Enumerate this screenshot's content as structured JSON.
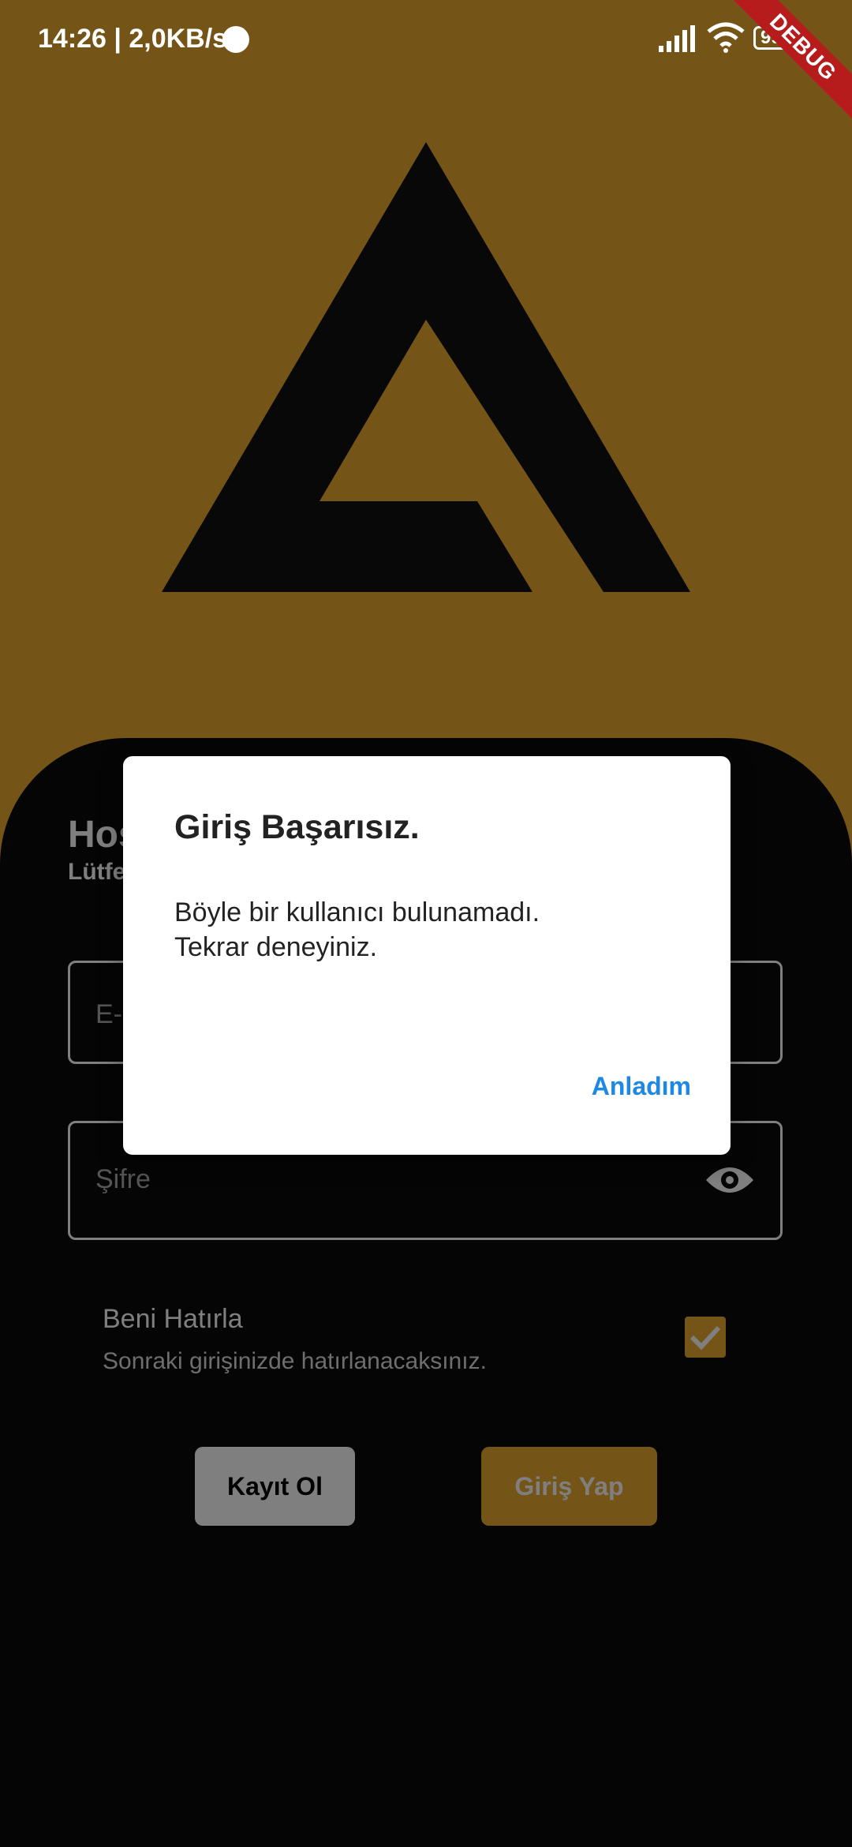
{
  "status_bar": {
    "time_speed": "14:26 | 2,0KB/s",
    "battery": "99",
    "debug_banner": "DEBUG"
  },
  "login": {
    "welcome_title": "Hoş",
    "welcome_subtitle": "Lütfe",
    "email_placeholder": "E-",
    "password_placeholder": "Şifre",
    "remember_title": "Beni Hatırla",
    "remember_subtitle": "Sonraki girişinizde hatırlanacaksınız.",
    "remember_checked": true,
    "register_button": "Kayıt Ol",
    "login_button": "Giriş Yap"
  },
  "dialog": {
    "title": "Giriş Başarısız.",
    "body_line1": "Böyle bir kullanıcı bulunamadı.",
    "body_line2": "Tekrar deneyiniz.",
    "action": "Anladım"
  },
  "colors": {
    "accent": "#e8ab2e",
    "background": "#0a0a0a",
    "dialog_action": "#1e88e5"
  }
}
